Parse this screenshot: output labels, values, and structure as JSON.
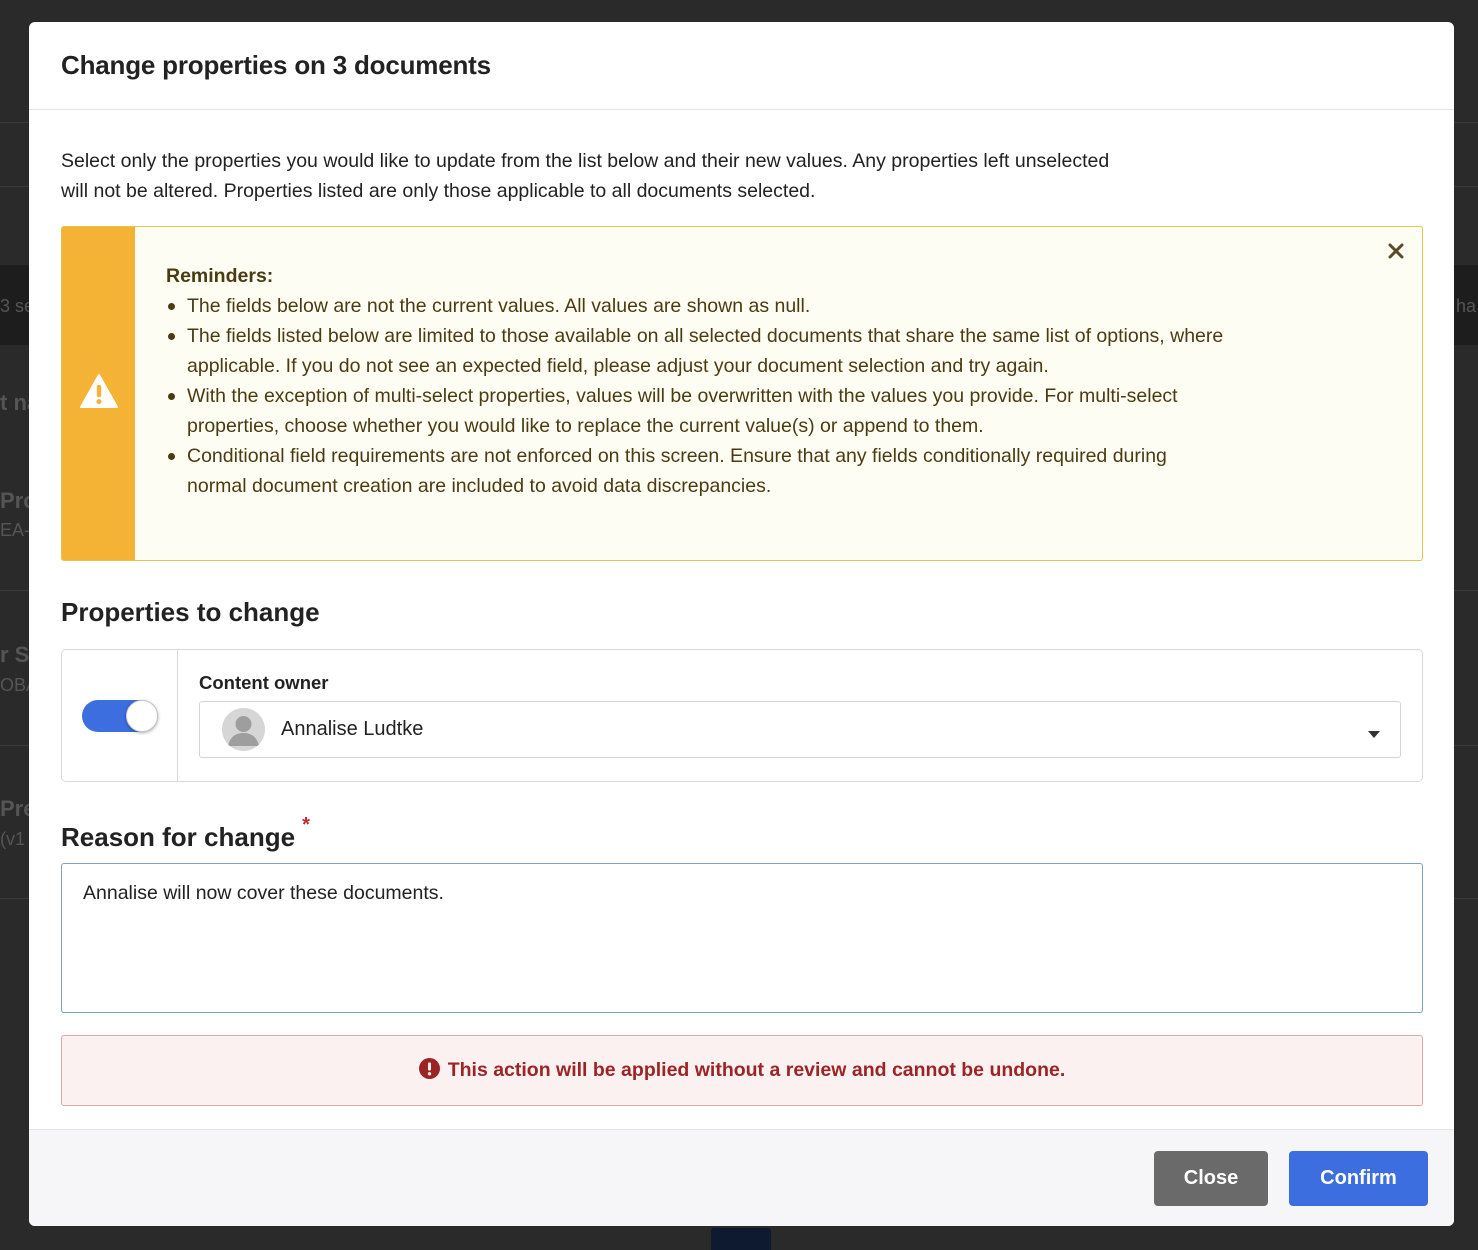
{
  "background": {
    "fragments": [
      "3 se",
      "t na",
      "Pro",
      "EA-",
      "r Se",
      "OBA",
      "Pre",
      "(v1",
      "ha"
    ]
  },
  "modal": {
    "title": "Change properties on 3 documents",
    "intro": "Select only the properties you would like to update from the list below and their new values. Any properties left unselected will not be altered. Properties listed are only those applicable to all documents selected.",
    "reminders": {
      "icon": "warning-triangle-icon",
      "heading": "Reminders:",
      "items": [
        "The fields below are not the current values. All values are shown as null.",
        "The fields listed below are limited to those available on all selected documents that share the same list of options, where applicable. If you do not see an expected field, please adjust your document selection and try again.",
        "With the exception of multi-select properties, values will be overwritten with the values you provide. For multi-select properties, choose whether you would like to replace the current value(s) or append to them.",
        "Conditional field requirements are not enforced on this screen. Ensure that any fields conditionally required during normal document creation are included to avoid data discrepancies."
      ]
    },
    "properties": {
      "title": "Properties to change",
      "items": [
        {
          "enabled": true,
          "label": "Content owner",
          "value": "Annalise Ludtke"
        }
      ]
    },
    "reason": {
      "title": "Reason for change",
      "required_marker": "*",
      "value": "Annalise will now cover these documents."
    },
    "warning": {
      "icon": "exclamation-circle-icon",
      "text": "This action will be applied without a review and cannot be undone."
    },
    "footer": {
      "close_label": "Close",
      "confirm_label": "Confirm"
    }
  },
  "colors": {
    "primary": "#3d6ee0",
    "reminder_stripe": "#f5b335",
    "danger_text": "#9b2525",
    "close_button": "#6a6a6a"
  }
}
